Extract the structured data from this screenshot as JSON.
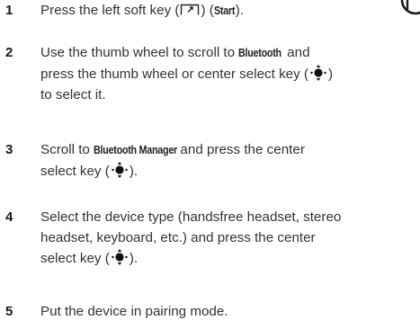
{
  "icons": {
    "corner": "device-outline-icon",
    "soft_key": "left-soft-key-icon",
    "nav_key": "center-select-key-icon"
  },
  "steps": [
    {
      "number": "1",
      "parts": [
        "Press the left soft key (",
        ") (",
        "Start",
        ")."
      ]
    },
    {
      "number": "2",
      "parts": [
        "Use the thumb wheel to scroll to ",
        "Bluetooth",
        " and",
        "press the thumb wheel or center select key (",
        ")",
        "to select it."
      ]
    },
    {
      "number": "3",
      "parts": [
        "Scroll to ",
        "Bluetooth Manager",
        " and press the center",
        "select key (",
        ")."
      ]
    },
    {
      "number": "4",
      "parts": [
        "Select the device type (handsfree headset, stereo",
        "headset, keyboard, etc.) and press the center",
        "select key (",
        ")."
      ]
    },
    {
      "number": "5",
      "parts": [
        "Put the device in pairing mode."
      ]
    }
  ]
}
